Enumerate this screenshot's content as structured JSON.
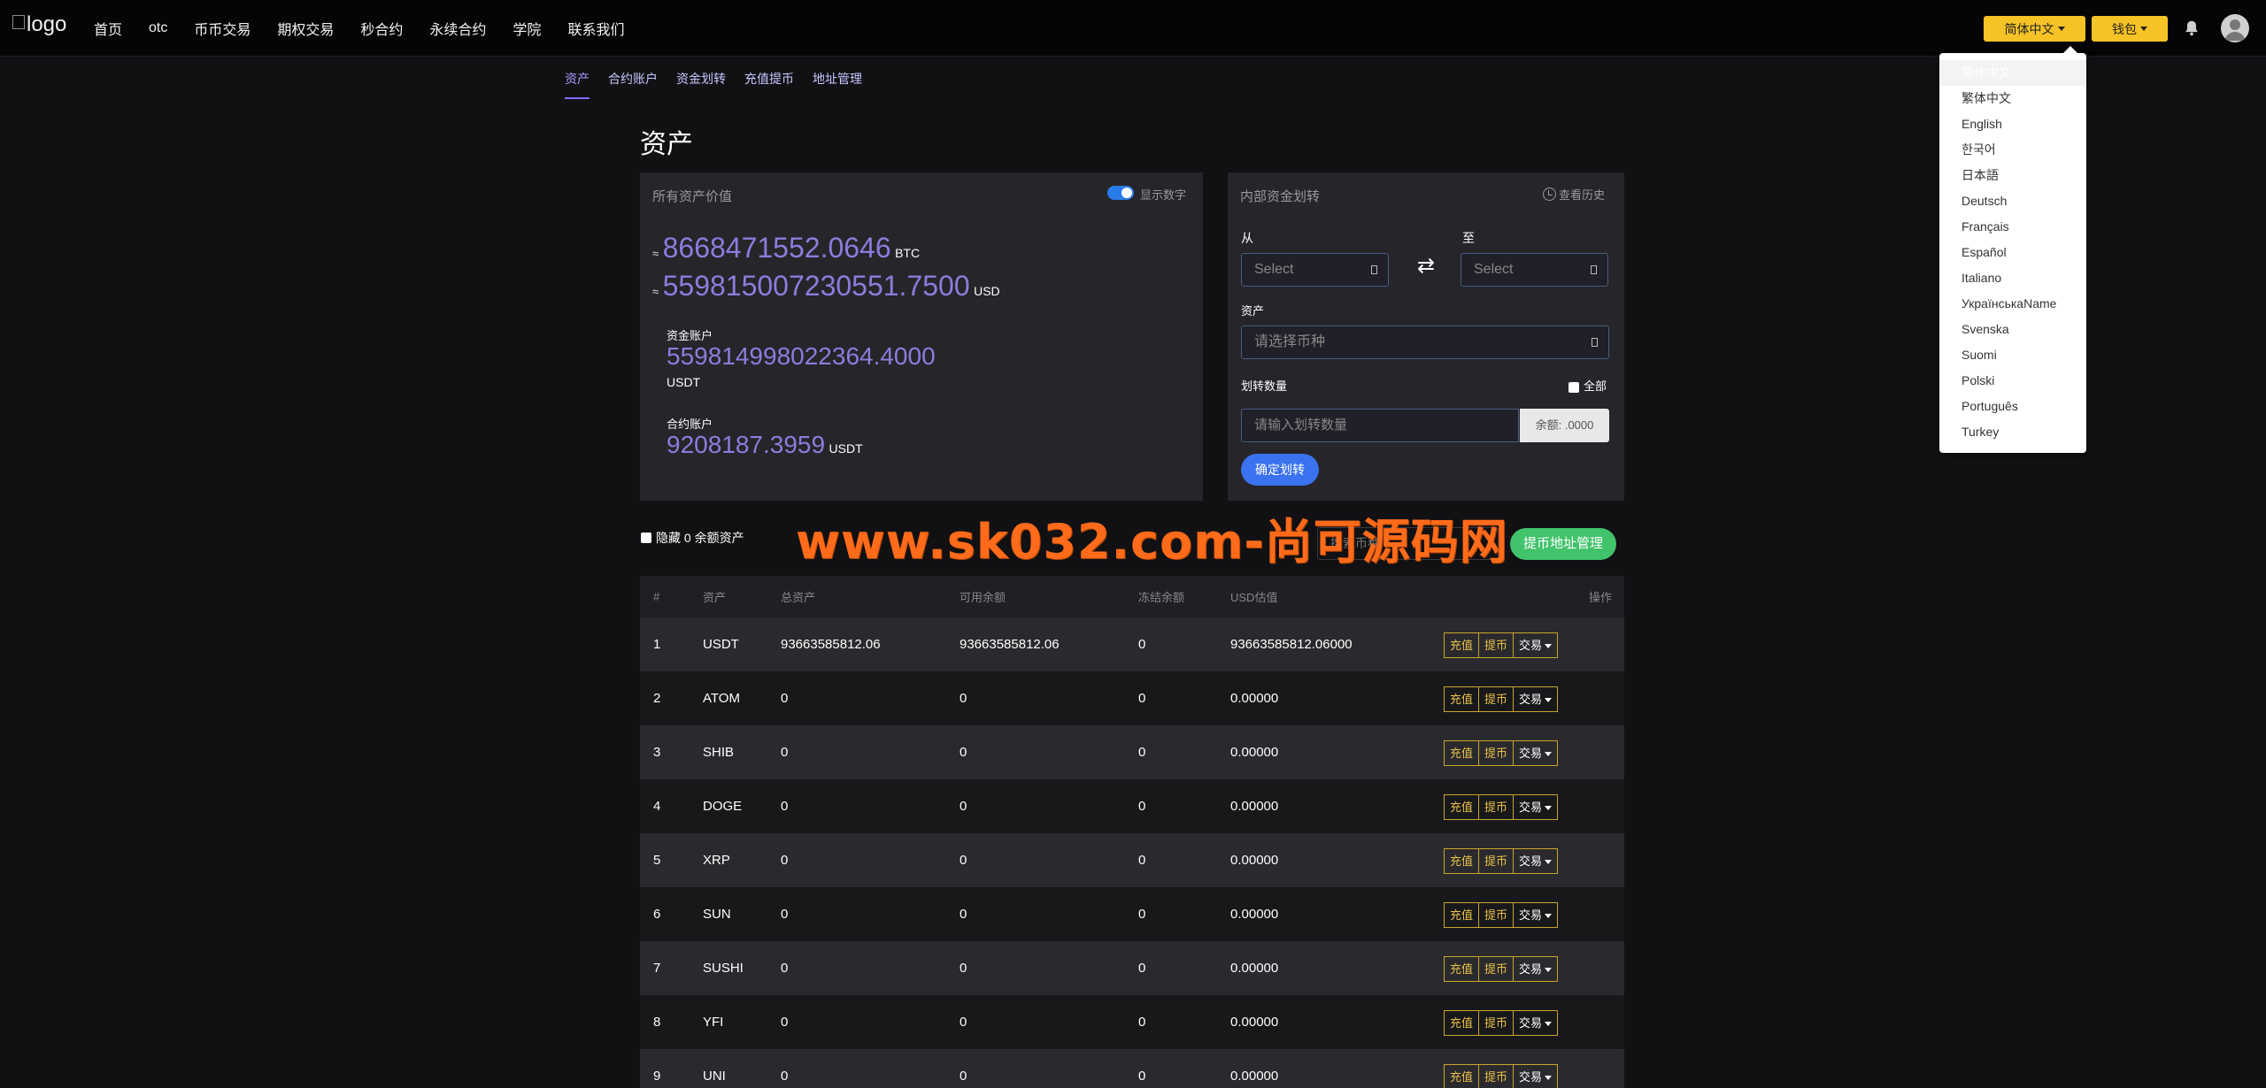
{
  "navbar": {
    "logo_alt": "logo",
    "items": [
      "首页",
      "otc",
      "币币交易",
      "期权交易",
      "秒合约",
      "永续合约",
      "学院",
      "联系我们"
    ],
    "lang_label": "简体中文",
    "wallet_label": "钱包"
  },
  "lang_menu": [
    "简体中文",
    "繁体中文",
    "English",
    "한국어",
    "日本語",
    "Deutsch",
    "Français",
    "Español",
    "Italiano",
    "УкраїнськаName",
    "Svenska",
    "Suomi",
    "Polski",
    "Português",
    "Turkey"
  ],
  "subtabs": [
    "资产",
    "合约账户",
    "资金划转",
    "充值提币",
    "地址管理"
  ],
  "page_title": "资产",
  "assets_panel": {
    "title": "所有资产价值",
    "toggle_label": "显示数字",
    "approx": "≈",
    "btc_value": "8668471552.0646",
    "btc_unit": "BTC",
    "usd_value": "559815007230551.7500",
    "usd_unit": "USD",
    "fund_label": "资金账户",
    "fund_value": "559814998022364.4000",
    "fund_unit": "USDT",
    "contract_label": "合约账户",
    "contract_value": "9208187.3959",
    "contract_unit": "USDT"
  },
  "transfer_panel": {
    "title": "内部资金划转",
    "history_label": "查看历史",
    "from_label": "从",
    "to_label": "至",
    "from_placeholder": "Select",
    "to_placeholder": "Select",
    "asset_label": "资产",
    "asset_placeholder": "请选择币种",
    "amount_label": "划转数量",
    "all_label": "全部",
    "amount_placeholder": "请输入划转数量",
    "balance_label": "余额: .0000",
    "confirm_label": "确定划转"
  },
  "filter": {
    "hide_zero_label": "隐藏 0 余额资产",
    "search_placeholder": "搜索币种",
    "address_button": "提币地址管理"
  },
  "watermark": "www.sk032.com-尚可源码网",
  "table": {
    "headers": [
      "#",
      "资产",
      "总资产",
      "可用余额",
      "冻结余额",
      "USD估值",
      "操作"
    ],
    "actions": [
      "充值",
      "提币",
      "交易"
    ],
    "rows": [
      [
        "1",
        "USDT",
        "93663585812.06",
        "93663585812.06",
        "0",
        "93663585812.06000"
      ],
      [
        "2",
        "ATOM",
        "0",
        "0",
        "0",
        "0.00000"
      ],
      [
        "3",
        "SHIB",
        "0",
        "0",
        "0",
        "0.00000"
      ],
      [
        "4",
        "DOGE",
        "0",
        "0",
        "0",
        "0.00000"
      ],
      [
        "5",
        "XRP",
        "0",
        "0",
        "0",
        "0.00000"
      ],
      [
        "6",
        "SUN",
        "0",
        "0",
        "0",
        "0.00000"
      ],
      [
        "7",
        "SUSHI",
        "0",
        "0",
        "0",
        "0.00000"
      ],
      [
        "8",
        "YFI",
        "0",
        "0",
        "0",
        "0.00000"
      ],
      [
        "9",
        "UNI",
        "0",
        "0",
        "0",
        "0.00000"
      ]
    ]
  }
}
